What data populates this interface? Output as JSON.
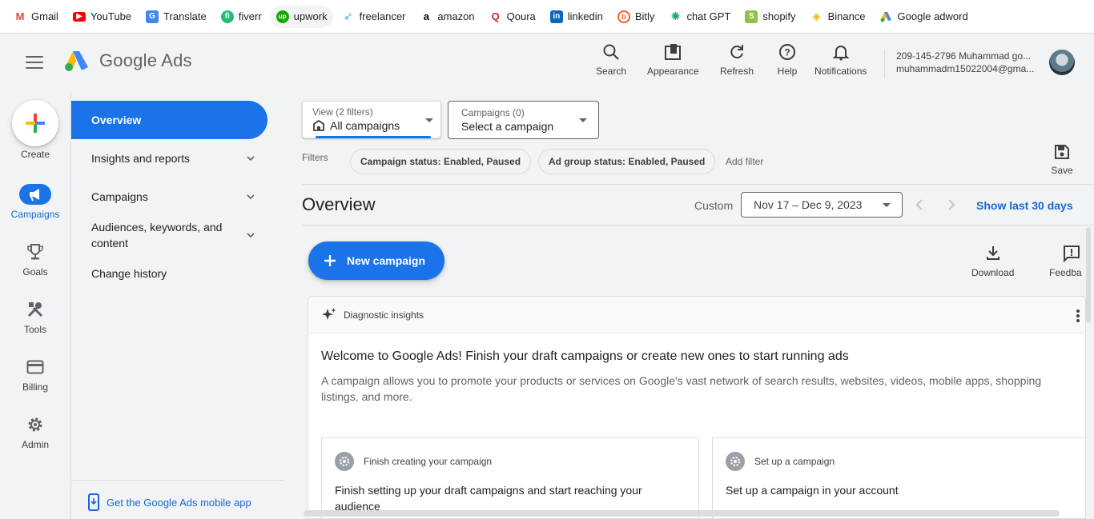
{
  "bookmarks": [
    {
      "label": "Gmail",
      "icon": "gmail-icon",
      "color": "#ea4335"
    },
    {
      "label": "YouTube",
      "icon": "youtube-icon",
      "color": "#ff0000"
    },
    {
      "label": "Translate",
      "icon": "translate-icon",
      "color": "#4285f4"
    },
    {
      "label": "fiverr",
      "icon": "fiverr-icon",
      "color": "#1dbf73"
    },
    {
      "label": "upwork",
      "icon": "upwork-icon",
      "color": "#14a800"
    },
    {
      "label": "freelancer",
      "icon": "freelancer-icon",
      "color": "#29b2fe"
    },
    {
      "label": "amazon",
      "icon": "amazon-icon",
      "color": "#000000"
    },
    {
      "label": "Qoura",
      "icon": "quora-icon",
      "color": "#b92b27"
    },
    {
      "label": "linkedin",
      "icon": "linkedin-icon",
      "color": "#0a66c2"
    },
    {
      "label": "Bitly",
      "icon": "bitly-icon",
      "color": "#ee6123"
    },
    {
      "label": "chat GPT",
      "icon": "chatgpt-icon",
      "color": "#10a37f"
    },
    {
      "label": "shopify",
      "icon": "shopify-icon",
      "color": "#95bf47"
    },
    {
      "label": "Binance",
      "icon": "binance-icon",
      "color": "#f0b90b"
    },
    {
      "label": "Google adword",
      "icon": "google-ads-icon",
      "color": "#4285f4"
    }
  ],
  "header": {
    "logo_text": "Google Ads",
    "actions": [
      {
        "label": "Search",
        "icon": "search-icon"
      },
      {
        "label": "Appearance",
        "icon": "appearance-icon"
      },
      {
        "label": "Refresh",
        "icon": "refresh-icon"
      },
      {
        "label": "Help",
        "icon": "help-icon"
      },
      {
        "label": "Notifications",
        "icon": "bell-icon"
      }
    ],
    "account_line1": "209-145-2796 Muhammad go...",
    "account_line2": "muhammadm15022004@gma..."
  },
  "rail": {
    "create_label": "Create",
    "items": [
      {
        "label": "Campaigns",
        "icon": "megaphone-icon"
      },
      {
        "label": "Goals",
        "icon": "trophy-icon"
      },
      {
        "label": "Tools",
        "icon": "tools-icon"
      },
      {
        "label": "Billing",
        "icon": "credit-card-icon"
      },
      {
        "label": "Admin",
        "icon": "gear-icon"
      }
    ]
  },
  "subnav": {
    "items": [
      {
        "label": "Overview"
      },
      {
        "label": "Insights and reports"
      },
      {
        "label": "Campaigns"
      },
      {
        "label": "Audiences, keywords, and content"
      },
      {
        "label": "Change history"
      }
    ],
    "mobile_app": "Get the Google Ads mobile app"
  },
  "main": {
    "view_filter": {
      "small": "View (2 filters)",
      "value": "All campaigns"
    },
    "campaign_select": {
      "small": "Campaigns (0)",
      "value": "Select a campaign"
    },
    "filters_label": "Filters",
    "chips": [
      "Campaign status: Enabled, Paused",
      "Ad group status: Enabled, Paused"
    ],
    "add_filter": "Add filter",
    "save_label": "Save",
    "page_title": "Overview",
    "date_mode": "Custom",
    "date_range": "Nov 17 – Dec 9, 2023",
    "show_last": "Show last 30 days",
    "new_campaign": "New campaign",
    "download_label": "Download",
    "feedback_label": "Feedba",
    "card": {
      "header": "Diagnostic insights",
      "title": "Welcome to Google Ads! Finish your draft campaigns or create new ones to start running ads",
      "body": "A campaign allows you to promote your products or services on Google's vast network of search results, websites, videos, mobile apps, shopping listings, and more.",
      "sub1_head": "Finish creating your campaign",
      "sub1_title": "Finish setting up your draft campaigns and start reaching your audience",
      "sub2_head": "Set up a campaign",
      "sub2_title": "Set up a campaign in your account"
    }
  },
  "colors": {
    "accent": "#1a73e8",
    "link": "#1967d2"
  }
}
